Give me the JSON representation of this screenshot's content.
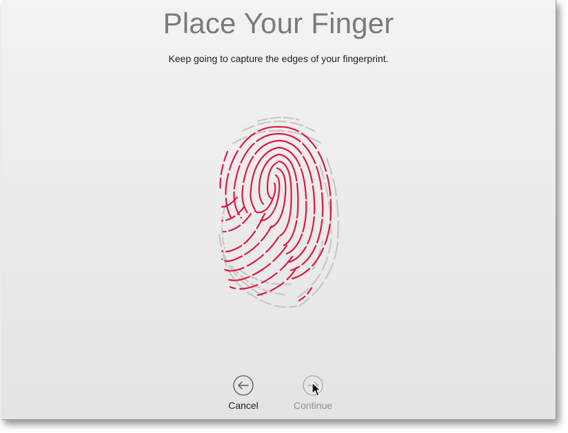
{
  "header": {
    "title": "Place Your Finger",
    "subtitle": "Keep going to capture the edges of your fingerprint."
  },
  "fingerprint": {
    "icon": "fingerprint-icon",
    "captured_color": "#e0173f",
    "uncaptured_color": "#c4c4c4"
  },
  "actions": {
    "cancel_label": "Cancel",
    "continue_label": "Continue"
  }
}
